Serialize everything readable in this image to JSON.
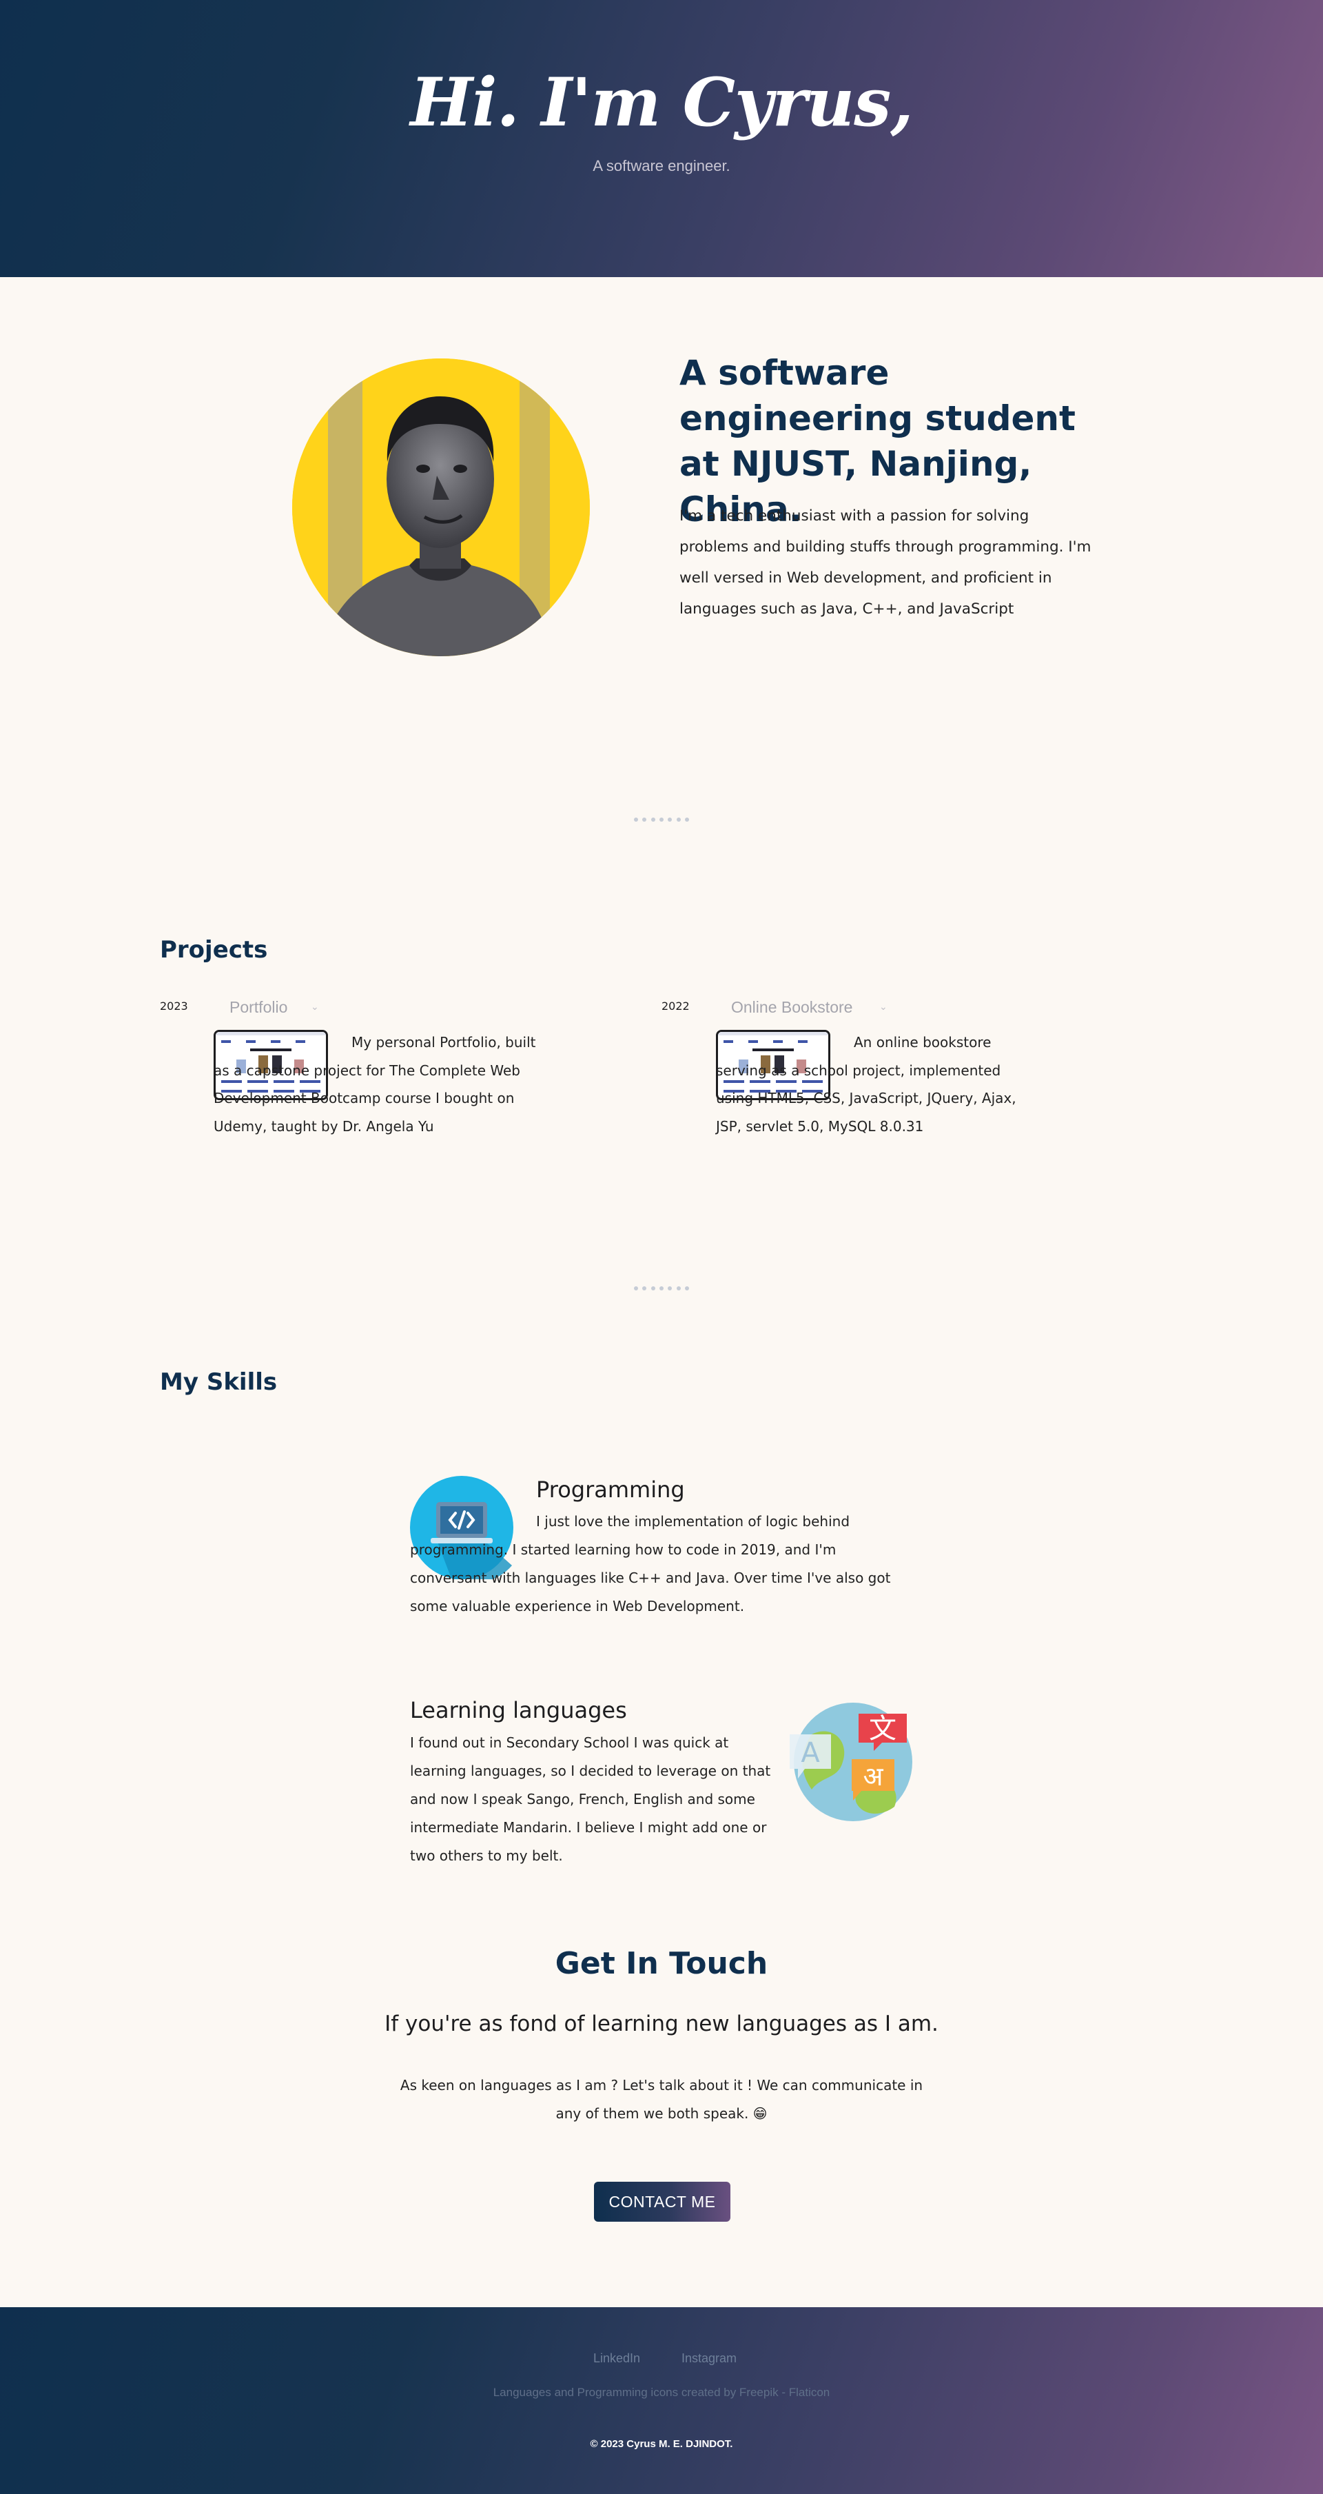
{
  "hero": {
    "title": "Hi. I'm Cyrus,",
    "tagline": "A software engineer."
  },
  "about": {
    "title": "A software engineering student at NJUST, Nanjing, China.",
    "text": "I'm a tech enthusiast with a passion for solving problems and building stuffs through programming. I'm well versed in Web development, and proficient in languages such as Java, C++, and JavaScript"
  },
  "projects": {
    "heading": "Projects",
    "items": [
      {
        "year": "2023",
        "name": "Portfolio",
        "description": "My personal Portfolio, built as a capstone project for The Complete Web Development Bootcamp course I bought on Udemy, taught by Dr. Angela Yu"
      },
      {
        "year": "2022",
        "name": "Online Bookstore",
        "description": "An online bookstore serving as a school project, implemented using HTML5, CSS, JavaScript, JQuery, Ajax, JSP, servlet 5.0, MySQL 8.0.31"
      }
    ]
  },
  "skills": {
    "heading": "My Skills",
    "items": [
      {
        "title": "Programming",
        "text": "I just love the implementation of logic behind programming. I started learning how to code in 2019, and I'm conversant with languages like C++ and Java. Over time I've also got some valuable experience in Web Development.",
        "icon": "programming-icon"
      },
      {
        "title": "Learning languages",
        "text": "I found out in Secondary School I was quick at learning languages, so I decided to leverage on that and now I speak Sango, French, English and some intermediate Mandarin. I believe I might add one or two others to my belt.",
        "icon": "languages-icon",
        "icon_glyphs": [
          "A",
          "文",
          "अ"
        ]
      }
    ]
  },
  "contact": {
    "title": "Get In Touch",
    "subtitle": "If you're as fond of learning new languages as I am.",
    "text": "As keen on languages as I am ? Let's talk about it ! We can communicate in any of them we both speak. 😁",
    "button": "CONTACT ME"
  },
  "footer": {
    "links": [
      "LinkedIn",
      "Instagram"
    ],
    "credits": "Languages and Programming icons created by Freepik - Flaticon",
    "copyright": "© 2023 Cyrus M. E. DJINDOT."
  },
  "colors": {
    "primary": "#0f2f4e",
    "accent": "#815a86",
    "background": "#fcf8f3",
    "avatar_bg": "#ffd31a"
  }
}
